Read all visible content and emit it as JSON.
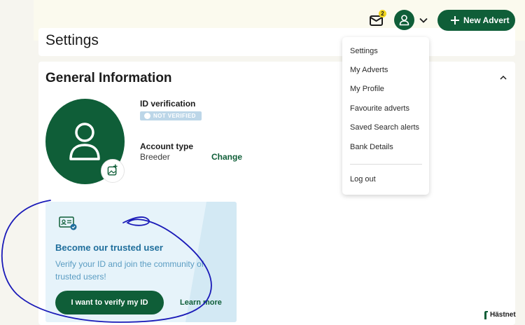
{
  "header": {
    "mail_badge_count": "2",
    "new_advert_label": "New Advert",
    "icons": [
      "mail-icon",
      "user-icon",
      "chevron-down-icon",
      "plus-icon"
    ]
  },
  "settings_section": {
    "title": "Settings"
  },
  "general_info": {
    "title": "General Information",
    "id_verification_label": "ID verification",
    "id_status": "NOT VERIFIED",
    "account_type_label": "Account type",
    "account_type_value": "Breeder",
    "change_label": "Change"
  },
  "trust_card": {
    "title": "Become our trusted user",
    "body": "Verify your ID and join the community of trusted users!",
    "verify_button": "I want to verify my ID",
    "learn_more": "Learn more"
  },
  "user_menu": {
    "items": [
      "Settings",
      "My Adverts",
      "My Profile",
      "Favourite adverts",
      "Saved Search alerts",
      "Bank Details"
    ],
    "logout": "Log out"
  },
  "brand": {
    "name": "Hästnet"
  },
  "colors": {
    "brand_green": "#0f5e38",
    "badge_yellow": "#f1d51f",
    "trust_bg": "#e6f3fa",
    "trust_title": "#1f6e9c",
    "annotation_ink": "#1a1ab8"
  }
}
